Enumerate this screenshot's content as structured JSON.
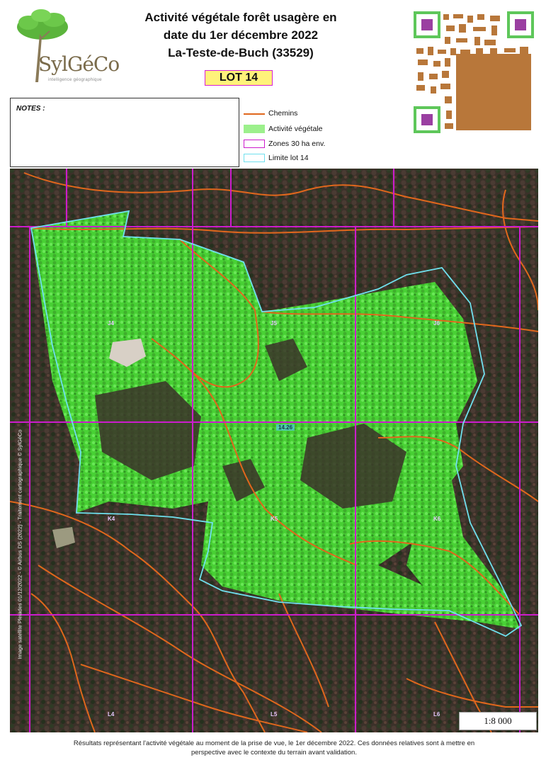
{
  "logo": {
    "brand": "SylGéCo",
    "tagline": "intelligence géographique"
  },
  "header": {
    "title_line1": "Activité végétale forêt usagère en",
    "title_line2": "date du 1er décembre 2022",
    "title_line3": "La-Teste-de-Buch (33529)",
    "lot_label": "LOT 14"
  },
  "notes": {
    "label": "NOTES :"
  },
  "legend": {
    "items": [
      {
        "label": "Chemins",
        "color": "#e0671c",
        "icon": "line-icon"
      },
      {
        "label": "Activité végétale",
        "color": "#9cf08c",
        "icon": "fill-icon"
      },
      {
        "label": "Zones 30 ha env.",
        "color": "#cc1ccc",
        "icon": "outline-icon"
      },
      {
        "label": "Limite lot 14",
        "color": "#6fe0ee",
        "icon": "outline-icon"
      }
    ]
  },
  "map": {
    "sidebar_credit": "Image satellite Pleiades 01/12/2022 - © Airbus DS (2022) - Traitement cartographique © SylGéCo",
    "lot_label": "14.26",
    "zone_labels": [
      "J4",
      "J5",
      "J6",
      "K4",
      "K5",
      "K6",
      "L4",
      "L5",
      "L6"
    ],
    "colors": {
      "vegetation": "#49d935",
      "zones": "#cc1ccc",
      "limit": "#6fe0ee",
      "paths": "#e0671c"
    }
  },
  "scale": {
    "label": "1:8 000"
  },
  "footer": {
    "line1": "Résultats représentant l'activité végétale au moment de la prise de vue, le 1er décembre 2022. Ces données relatives sont à mettre en",
    "line2": "perspective avec le contexte du terrain avant validation."
  }
}
